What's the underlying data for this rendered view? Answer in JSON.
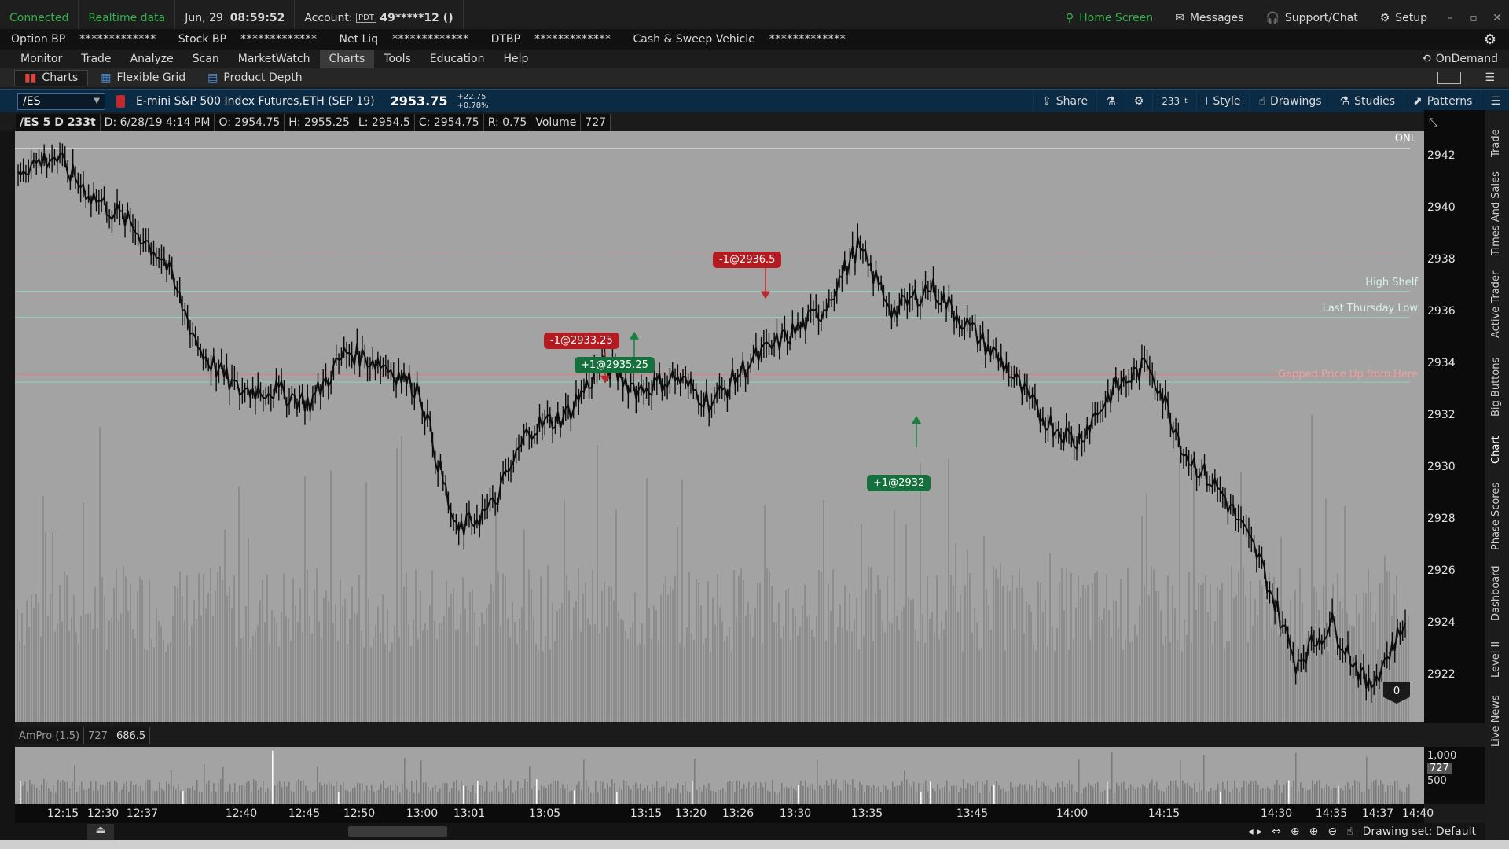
{
  "status": {
    "connected": "Connected",
    "realtime": "Realtime data",
    "date": "Jun, 29",
    "time": "08:59:52",
    "account_label": "Account:",
    "account_badge": "PDT",
    "account_value": "49*****12 ()",
    "home_screen": "Home Screen",
    "messages": "Messages",
    "support": "Support/Chat",
    "setup": "Setup"
  },
  "bp": {
    "option_bp": "Option BP",
    "stock_bp": "Stock BP",
    "net_liq": "Net Liq",
    "dtbp": "DTBP",
    "sweep": "Cash & Sweep Vehicle",
    "masked": "*************"
  },
  "menu": {
    "items": [
      "Monitor",
      "Trade",
      "Analyze",
      "Scan",
      "MarketWatch",
      "Charts",
      "Tools",
      "Education",
      "Help"
    ],
    "active": "Charts",
    "ondemand": "OnDemand"
  },
  "subtabs": {
    "charts": "Charts",
    "flexible_grid": "Flexible Grid",
    "product_depth": "Product Depth"
  },
  "symbol": {
    "value": "/ES",
    "name": "E-mini S&P 500 Index Futures,ETH (SEP 19)",
    "last": "2953.75",
    "change": "+22.75",
    "change_pct": "+0.78%"
  },
  "toolbar": {
    "share": "Share",
    "aggregation": "233",
    "aggregation_unit": "t",
    "style": "Style",
    "drawings": "Drawings",
    "studies": "Studies",
    "patterns": "Patterns"
  },
  "info": {
    "symbol": "/ES 5 D 233t",
    "date": "D: 6/28/19 4:14 PM",
    "open": "O: 2954.75",
    "high": "H: 2955.25",
    "low": "L: 2954.5",
    "close": "C: 2954.75",
    "range": "R: 0.75",
    "volume_label": "Volume",
    "volume": "727"
  },
  "chart_labels": {
    "onl": "ONL",
    "high_shelf": "High Shelf",
    "last_thursday_low": "Last Thursday Low",
    "gapped": "Gapped Price Up from Here",
    "badge": "0"
  },
  "orders": [
    {
      "label": "-1@2933.25",
      "side": "sell"
    },
    {
      "label": "+1@2935.25",
      "side": "buy"
    },
    {
      "label": "-1@2936.5",
      "side": "sell"
    },
    {
      "label": "+1@2932",
      "side": "buy"
    }
  ],
  "price_axis": [
    "2942",
    "2940",
    "2938",
    "2936",
    "2934",
    "2932",
    "2930",
    "2928",
    "2926",
    "2924",
    "2922"
  ],
  "time_axis": [
    "12:15",
    "12:30",
    "12:37",
    "12:40",
    "12:45",
    "12:50",
    "13:00",
    "13:01",
    "13:05",
    "13:15",
    "13:20",
    "13:26",
    "13:30",
    "13:35",
    "13:45",
    "14:00",
    "14:15",
    "14:30",
    "14:35",
    "14:37",
    "14:40"
  ],
  "volume_pane": {
    "study": "AmPro (1.5)",
    "v1": "727",
    "v2": "686.5",
    "axis_1000": "1,000",
    "axis_current": "727",
    "axis_500": "500"
  },
  "side_tabs": [
    "Trade",
    "Times And Sales",
    "Active Trader",
    "Big Buttons",
    "Chart",
    "Phase Scores",
    "Dashboard",
    "Level II",
    "Live News"
  ],
  "drawing_set": "Drawing set: Default",
  "colors": {
    "chart_bg": "#a3a3a3",
    "toolbar_bg": "#0b2a44",
    "connected": "#2fb24a",
    "sell": "#b31b21",
    "buy": "#16703d"
  },
  "chart_data": {
    "type": "line",
    "ylim": [
      2920.5,
      2943
    ],
    "x": [
      "12:15",
      "12:30",
      "12:37",
      "12:40",
      "12:45",
      "12:50",
      "13:00",
      "13:01",
      "13:05",
      "13:15",
      "13:20",
      "13:26",
      "13:30",
      "13:35",
      "13:45",
      "14:00",
      "14:15",
      "14:30",
      "14:35",
      "14:37",
      "14:40"
    ],
    "price_path": [
      2941.5,
      2942.0,
      2940.5,
      2939.5,
      2938.0,
      2934.5,
      2933.0,
      2933.0,
      2932.5,
      2934.5,
      2934.0,
      2933.0,
      2927.5,
      2928.5,
      2931.5,
      2932.0,
      2934.0,
      2933.0,
      2933.5,
      2932.5,
      2934.0,
      2935.0,
      2936.0,
      2938.5,
      2936.0,
      2937.0,
      2935.5,
      2934.0,
      2932.0,
      2931.0,
      2933.0,
      2934.0,
      2930.5,
      2929.0,
      2926.5,
      2922.5,
      2924.0,
      2921.5,
      2924.0
    ],
    "horizontal_lines": [
      {
        "label": "High Shelf",
        "value": 2936.8
      },
      {
        "label": "Last Thursday Low",
        "value": 2935.8
      },
      {
        "label": "Gapped Price Up from Here",
        "value": 2933.3
      }
    ],
    "orders": [
      {
        "label": "-1@2933.25",
        "value": 2933.25
      },
      {
        "label": "+1@2935.25",
        "value": 2935.25
      },
      {
        "label": "-1@2936.5",
        "value": 2936.5
      },
      {
        "label": "+1@2932",
        "value": 2932
      }
    ]
  }
}
